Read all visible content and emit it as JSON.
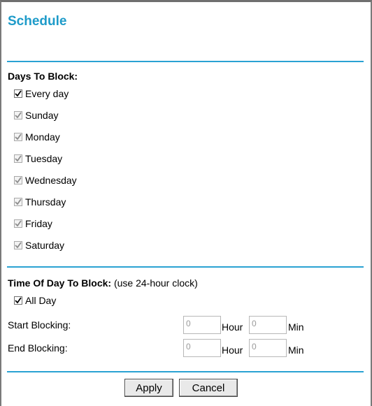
{
  "page": {
    "title": "Schedule"
  },
  "days": {
    "heading": "Days To Block:",
    "items": [
      {
        "label": "Every day",
        "checked": true,
        "enabled": true
      },
      {
        "label": "Sunday",
        "checked": true,
        "enabled": false
      },
      {
        "label": "Monday",
        "checked": true,
        "enabled": false
      },
      {
        "label": "Tuesday",
        "checked": true,
        "enabled": false
      },
      {
        "label": "Wednesday",
        "checked": true,
        "enabled": false
      },
      {
        "label": "Thursday",
        "checked": true,
        "enabled": false
      },
      {
        "label": "Friday",
        "checked": true,
        "enabled": false
      },
      {
        "label": "Saturday",
        "checked": true,
        "enabled": false
      }
    ]
  },
  "time": {
    "heading": "Time Of Day To Block:",
    "note": " (use 24-hour clock)",
    "all_day": {
      "label": "All Day",
      "checked": true
    },
    "start": {
      "label": "Start Blocking:",
      "hour": "0",
      "min": "0",
      "hour_unit": "Hour",
      "min_unit": "Min"
    },
    "end": {
      "label": "End Blocking:",
      "hour": "0",
      "min": "0",
      "hour_unit": "Hour",
      "min_unit": "Min"
    }
  },
  "buttons": {
    "apply": "Apply",
    "cancel": "Cancel"
  },
  "colors": {
    "accent": "#2aa2d3",
    "title": "#1e9bc9"
  }
}
